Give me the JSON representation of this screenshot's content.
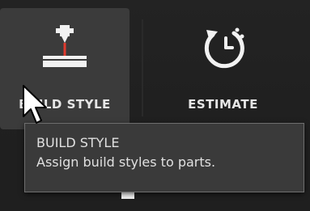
{
  "toolbar": {
    "build_style": {
      "label": "BUILD STYLE",
      "icon": "build-style-icon"
    },
    "estimate": {
      "label": "ESTIMATE",
      "icon": "timer-refresh-icon"
    }
  },
  "tooltip": {
    "title": "BUILD STYLE",
    "description": "Assign build styles to parts."
  },
  "colors": {
    "background": "#1f1f1f",
    "active_button": "#3b3b3b",
    "tooltip_bg": "#3a3a3a",
    "tooltip_border": "#6e6e6e",
    "text": "#e6e6e6"
  }
}
